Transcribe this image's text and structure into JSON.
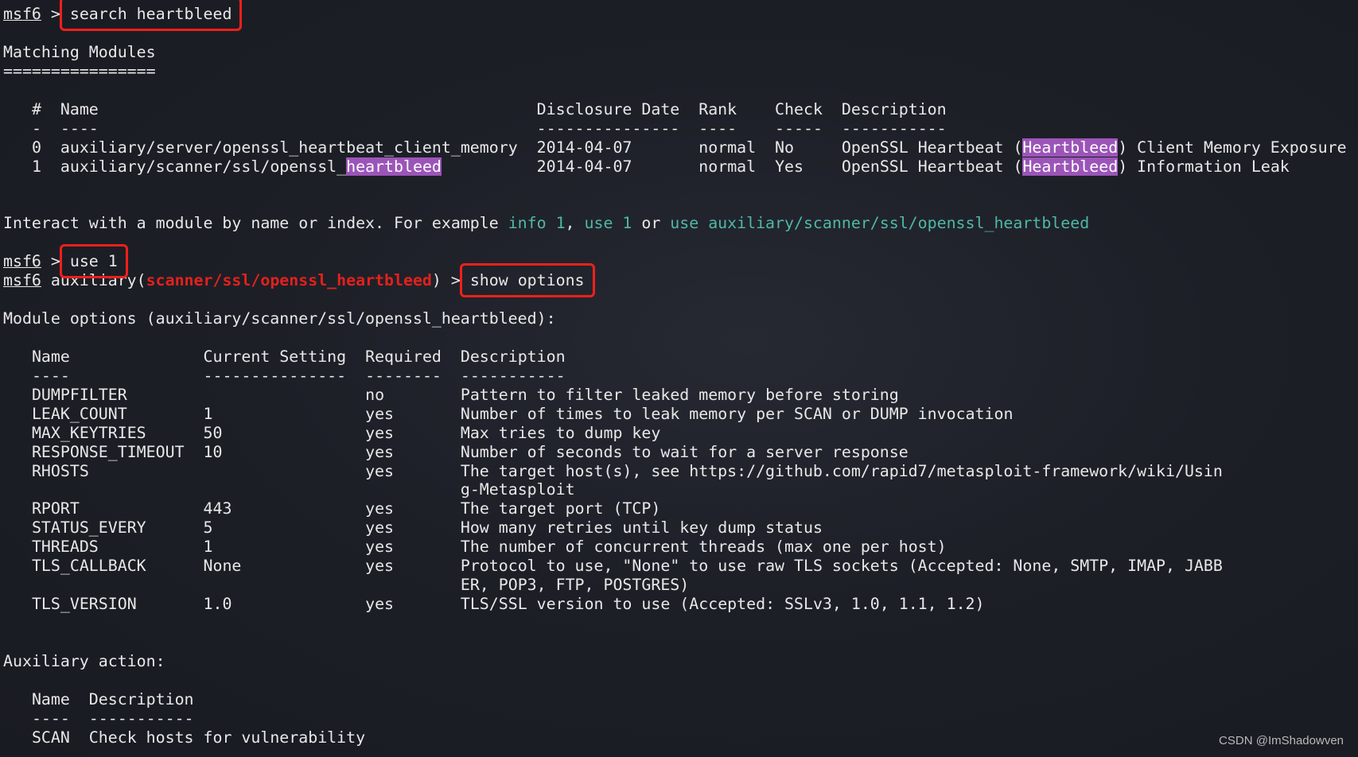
{
  "colors": {
    "background": "#1d1f27",
    "text": "#e8e8e8",
    "green": "#4fb8a6",
    "red": "#e3211c",
    "highlight": "#9b55b8",
    "annotation_box": "#f0201a"
  },
  "watermark": "CSDN @ImShadowven",
  "prompt1": {
    "prompt": "msf6",
    "sep": " > ",
    "command": "search heartbleed"
  },
  "matching": {
    "title": "Matching Modules",
    "underline": "================",
    "headers": [
      "#",
      "Name",
      "Disclosure Date",
      "Rank",
      "Check",
      "Description"
    ],
    "dashes": [
      "-",
      "----",
      "---------------",
      "----",
      "-----",
      "-----------"
    ],
    "rows": [
      [
        "0",
        [
          [
            "auxiliary/server/openssl_heartbeat_client_memory",
            ""
          ]
        ],
        "2014-04-07",
        "normal",
        "No",
        [
          [
            "OpenSSL Heartbeat (",
            ""
          ],
          [
            "Heartbleed",
            "p"
          ],
          [
            ") Client Memory Exposure",
            ""
          ]
        ]
      ],
      [
        "1",
        [
          [
            "auxiliary/scanner/ssl/openssl_",
            ""
          ],
          [
            "heartbleed",
            "p"
          ]
        ],
        "2014-04-07",
        "normal",
        "Yes",
        [
          [
            "OpenSSL Heartbeat (",
            ""
          ],
          [
            "Heartbleed",
            "p"
          ],
          [
            ") Information Leak",
            ""
          ]
        ]
      ]
    ]
  },
  "interact": [
    [
      "Interact with a module by name or index. For example ",
      ""
    ],
    [
      "info 1",
      "g"
    ],
    [
      ", ",
      ""
    ],
    [
      "use 1",
      "g"
    ],
    [
      " or ",
      ""
    ],
    [
      "use auxiliary/scanner/ssl/openssl_heartbleed",
      "g"
    ]
  ],
  "prompt2": {
    "prompt": "msf6",
    "sep": " > ",
    "command": "use 1"
  },
  "prompt3": {
    "prompt": "msf6",
    "pre": " auxiliary(",
    "module": "scanner/ssl/openssl_heartbleed",
    "post": ") > ",
    "command": "show options"
  },
  "options": {
    "title": "Module options (auxiliary/scanner/ssl/openssl_heartbleed):",
    "headers": [
      "Name",
      "Current Setting",
      "Required",
      "Description"
    ],
    "dashes": [
      "----",
      "---------------",
      "--------",
      "-----------"
    ],
    "rows": [
      [
        "DUMPFILTER",
        "",
        "no",
        [
          "Pattern to filter leaked memory before storing"
        ]
      ],
      [
        "LEAK_COUNT",
        "1",
        "yes",
        [
          "Number of times to leak memory per SCAN or DUMP invocation"
        ]
      ],
      [
        "MAX_KEYTRIES",
        "50",
        "yes",
        [
          "Max tries to dump key"
        ]
      ],
      [
        "RESPONSE_TIMEOUT",
        "10",
        "yes",
        [
          "Number of seconds to wait for a server response"
        ]
      ],
      [
        "RHOSTS",
        "",
        "yes",
        [
          "The target host(s), see https://github.com/rapid7/metasploit-framework/wiki/Usin",
          "g-Metasploit"
        ]
      ],
      [
        "RPORT",
        "443",
        "yes",
        [
          "The target port (TCP)"
        ]
      ],
      [
        "STATUS_EVERY",
        "5",
        "yes",
        [
          "How many retries until key dump status"
        ]
      ],
      [
        "THREADS",
        "1",
        "yes",
        [
          "The number of concurrent threads (max one per host)"
        ]
      ],
      [
        "TLS_CALLBACK",
        "None",
        "yes",
        [
          "Protocol to use, \"None\" to use raw TLS sockets (Accepted: None, SMTP, IMAP, JABB",
          "ER, POP3, FTP, POSTGRES)"
        ]
      ],
      [
        "TLS_VERSION",
        "1.0",
        "yes",
        [
          "TLS/SSL version to use (Accepted: SSLv3, 1.0, 1.1, 1.2)"
        ]
      ]
    ]
  },
  "action": {
    "title": "Auxiliary action:",
    "headers": [
      "Name",
      "Description"
    ],
    "dashes": [
      "----",
      "-----------"
    ],
    "rows": [
      [
        "SCAN",
        "Check hosts for vulnerability"
      ]
    ]
  }
}
